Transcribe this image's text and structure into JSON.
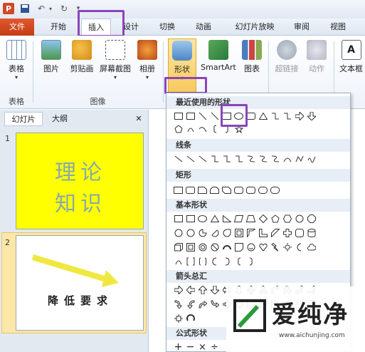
{
  "tabs": {
    "file": "文件",
    "home": "开始",
    "insert": "插入",
    "design": "设计",
    "transitions": "切换",
    "animations": "动画",
    "slideshow": "幻灯片放映",
    "review": "审阅",
    "view": "视图"
  },
  "ribbon": {
    "table": "表格",
    "picture": "图片",
    "clipart": "剪贴画",
    "screenshot": "屏幕截图",
    "album": "相册",
    "shapes": "形状",
    "smartart": "SmartArt",
    "chart": "图表",
    "hyperlink": "超链接",
    "action": "动作",
    "textbox": "文本框",
    "group_table": "表格",
    "group_images": "图像"
  },
  "panel": {
    "tab_slides": "幻灯片",
    "tab_outline": "大纲",
    "close": "✕",
    "slide1_num": "1",
    "slide1_text1": "理论",
    "slide1_text2": "知识",
    "slide2_num": "2",
    "slide2_text": "降低要求"
  },
  "gallery": {
    "recent": "最近使用的形状",
    "lines": "线条",
    "rect": "矩形",
    "basic": "基本形状",
    "arrows": "箭头总汇",
    "equation": "公式形状"
  },
  "watermark": {
    "name": "爱纯净",
    "url": "www.aichunjing.com"
  },
  "colors": {
    "highlight": "#8b45b8",
    "slide1_bg": "#ffff00",
    "file_tab": "#d04a20"
  }
}
